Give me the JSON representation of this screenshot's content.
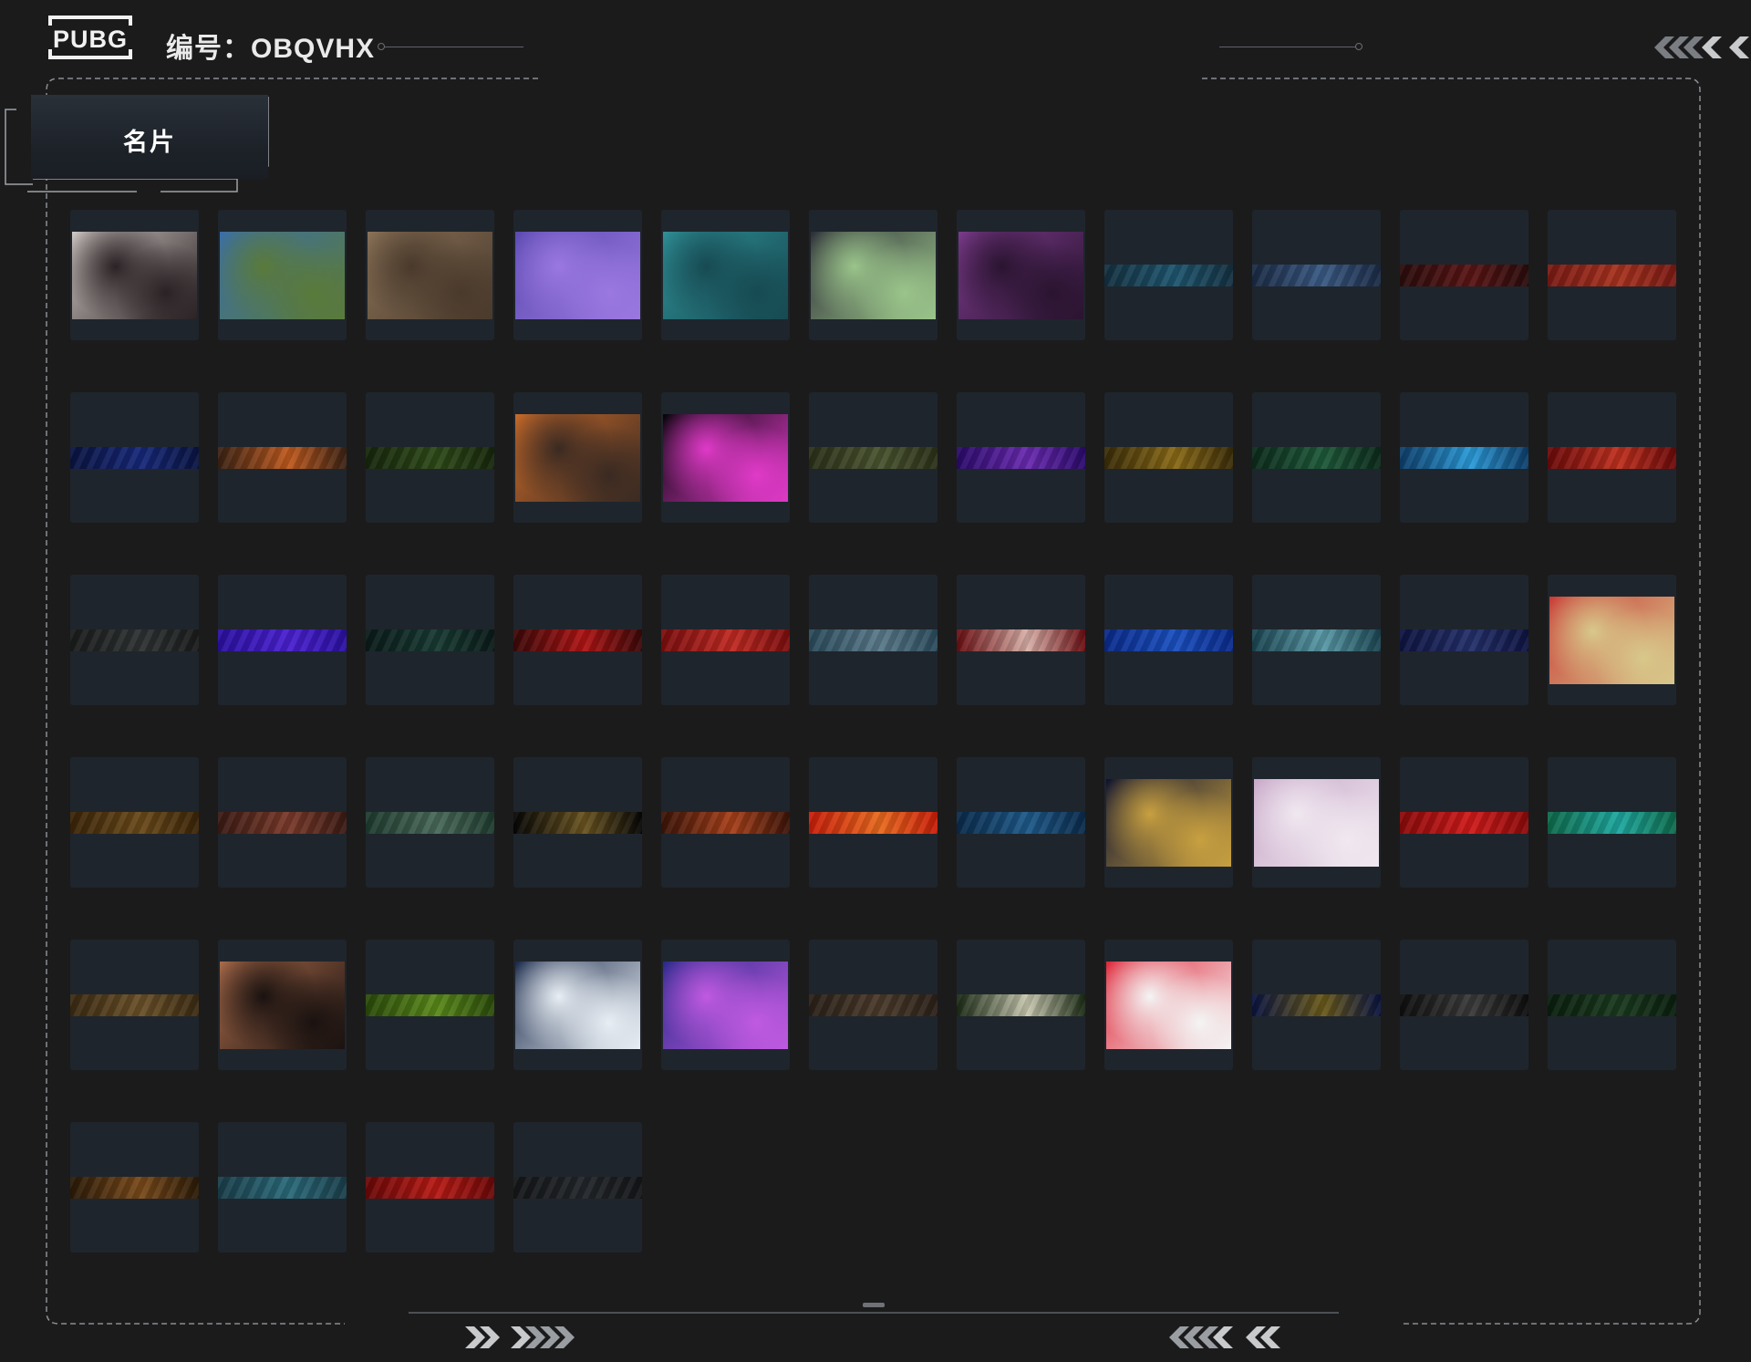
{
  "header": {
    "logo_text": "PUBG",
    "id_label": "编号：OBQVHX"
  },
  "tab": {
    "label": "名片"
  },
  "icons": {
    "header_right": "double-chevron-left-icon",
    "bottom_left": "double-chevron-right-icon",
    "bottom_right": "double-chevron-left-icon"
  },
  "cards": [
    {
      "kind": "image",
      "theme": "woman-portrait-black-nails",
      "c1": "#cfc8c4",
      "c2": "#2a2224"
    },
    {
      "kind": "image",
      "theme": "man-blue-shirt-field",
      "c1": "#3a6ea8",
      "c2": "#5a7a3a"
    },
    {
      "kind": "image",
      "theme": "soldier-desert",
      "c1": "#8a7258",
      "c2": "#4a3a2c"
    },
    {
      "kind": "image",
      "theme": "purple-disco-ball",
      "c1": "#5b4ab0",
      "c2": "#9a78e0"
    },
    {
      "kind": "image",
      "theme": "teal-handprint",
      "c1": "#2f8f96",
      "c2": "#174a52"
    },
    {
      "kind": "image",
      "theme": "man-sunglasses-money",
      "c1": "#2e2f38",
      "c2": "#9ac48a"
    },
    {
      "kind": "image",
      "theme": "purple-hair-woman",
      "c1": "#7a3a8a",
      "c2": "#2a1430"
    },
    {
      "kind": "strip",
      "theme": "blue-circuit",
      "c1": "#143040",
      "c2": "#1e5670"
    },
    {
      "kind": "strip",
      "theme": "moon-phases",
      "c1": "#1a2a44",
      "c2": "#3a5a84"
    },
    {
      "kind": "strip",
      "theme": "dark-red",
      "c1": "#2a0c0c",
      "c2": "#5a1414"
    },
    {
      "kind": "strip",
      "theme": "red-cards",
      "c1": "#7a1a14",
      "c2": "#a8321e"
    },
    {
      "kind": "strip",
      "theme": "navy-lines",
      "c1": "#0a1440",
      "c2": "#16287a"
    },
    {
      "kind": "strip",
      "theme": "brown-orange-dna",
      "c1": "#3a2214",
      "c2": "#c05a1e"
    },
    {
      "kind": "strip",
      "theme": "dark-green-camo",
      "c1": "#16260c",
      "c2": "#2e4a18"
    },
    {
      "kind": "image",
      "theme": "comic-monster",
      "c1": "#c86a2a",
      "c2": "#3a2a22"
    },
    {
      "kind": "image",
      "theme": "pink-equalizer",
      "c1": "#050508",
      "c2": "#e03ac8"
    },
    {
      "kind": "strip",
      "theme": "olive-text",
      "c1": "#2a3018",
      "c2": "#4a5430"
    },
    {
      "kind": "strip",
      "theme": "purple-blue-swirl",
      "c1": "#2a0a6a",
      "c2": "#6a2ab0"
    },
    {
      "kind": "strip",
      "theme": "gold-symbols",
      "c1": "#3a2c08",
      "c2": "#8a6a16"
    },
    {
      "kind": "strip",
      "theme": "green-pattern",
      "c1": "#0c2a1a",
      "c2": "#1e5a3a"
    },
    {
      "kind": "strip",
      "theme": "bright-blue-glow",
      "c1": "#0e3e6a",
      "c2": "#2a9ad8"
    },
    {
      "kind": "strip",
      "theme": "red-ornate",
      "c1": "#6a0a0a",
      "c2": "#c0301e"
    },
    {
      "kind": "strip",
      "theme": "charcoal-texture",
      "c1": "#1a1c1c",
      "c2": "#2e3232"
    },
    {
      "kind": "strip",
      "theme": "violet-texture",
      "c1": "#2a10a0",
      "c2": "#4a20d0"
    },
    {
      "kind": "strip",
      "theme": "dark-teal-dragon",
      "c1": "#0a1a18",
      "c2": "#183a32"
    },
    {
      "kind": "strip",
      "theme": "deep-red-streak",
      "c1": "#3a0808",
      "c2": "#b01414"
    },
    {
      "kind": "strip",
      "theme": "red-circles",
      "c1": "#7a0e0e",
      "c2": "#c02a22"
    },
    {
      "kind": "strip",
      "theme": "mountains-dusk",
      "c1": "#2a4a5a",
      "c2": "#5a7a8a"
    },
    {
      "kind": "strip",
      "theme": "red-dragon-scales",
      "c1": "#6a0e12",
      "c2": "#d8b0a8"
    },
    {
      "kind": "strip",
      "theme": "royal-blue-pattern",
      "c1": "#0a2a8a",
      "c2": "#1a50c0"
    },
    {
      "kind": "strip",
      "theme": "teal-dragon",
      "c1": "#1a4450",
      "c2": "#5a9aa8"
    },
    {
      "kind": "strip",
      "theme": "midnight-pattern",
      "c1": "#0e1440",
      "c2": "#24306a"
    },
    {
      "kind": "image",
      "theme": "red-hooded-skull",
      "c1": "#c83a36",
      "c2": "#d8c88a"
    },
    {
      "kind": "strip",
      "theme": "brown-gold-texture",
      "c1": "#3a2408",
      "c2": "#6a4a1a"
    },
    {
      "kind": "strip",
      "theme": "rust-swirl",
      "c1": "#3a1a14",
      "c2": "#7a3a2a"
    },
    {
      "kind": "strip",
      "theme": "green-paint-hand",
      "c1": "#1e3a2e",
      "c2": "#4a6a5a"
    },
    {
      "kind": "strip",
      "theme": "black-gold-ornament",
      "c1": "#060606",
      "c2": "#6a5420"
    },
    {
      "kind": "strip",
      "theme": "orange-ornate",
      "c1": "#3a1408",
      "c2": "#a8401a"
    },
    {
      "kind": "strip",
      "theme": "bright-red-orange",
      "c1": "#c81e0a",
      "c2": "#e86a1e"
    },
    {
      "kind": "strip",
      "theme": "deep-blue-wave",
      "c1": "#0a2a4a",
      "c2": "#1e5a8a"
    },
    {
      "kind": "image",
      "theme": "night-gold-text",
      "c1": "#0e1230",
      "c2": "#c8a040"
    },
    {
      "kind": "image",
      "theme": "cute-bunnies-pink",
      "c1": "#c8a8c8",
      "c2": "#f0e8f0"
    },
    {
      "kind": "strip",
      "theme": "crimson-ribbon",
      "c1": "#8a0a0a",
      "c2": "#d01a1a"
    },
    {
      "kind": "strip",
      "theme": "emerald-cyan",
      "c1": "#0e6a4a",
      "c2": "#1ea8a0"
    },
    {
      "kind": "strip",
      "theme": "snake-skin",
      "c1": "#3a2a12",
      "c2": "#6a5028"
    },
    {
      "kind": "image",
      "theme": "sniper-silhouette",
      "c1": "#a86a4a",
      "c2": "#1a1210"
    },
    {
      "kind": "strip",
      "theme": "lime-camo",
      "c1": "#2a4a0a",
      "c2": "#5a8a1a"
    },
    {
      "kind": "image",
      "theme": "astronaut-earth",
      "c1": "#1a2a4a",
      "c2": "#e8eef4"
    },
    {
      "kind": "image",
      "theme": "neon-race-track",
      "c1": "#2a2a8a",
      "c2": "#c05ae0"
    },
    {
      "kind": "strip",
      "theme": "dusty-brown",
      "c1": "#2a2018",
      "c2": "#4a3a2a"
    },
    {
      "kind": "strip",
      "theme": "shark-teeth",
      "c1": "#1a2a14",
      "c2": "#c8c8b0"
    },
    {
      "kind": "image",
      "theme": "red-race-car",
      "c1": "#e0283a",
      "c2": "#f4f4f4"
    },
    {
      "kind": "strip",
      "theme": "navy-gold-wave",
      "c1": "#0a1440",
      "c2": "#6a5a1a"
    },
    {
      "kind": "strip",
      "theme": "black-graffiti",
      "c1": "#0e0e0e",
      "c2": "#3a3a3a"
    },
    {
      "kind": "strip",
      "theme": "dark-green-eye",
      "c1": "#0a1e0e",
      "c2": "#1a3a1e"
    },
    {
      "kind": "strip",
      "theme": "wood-grain",
      "c1": "#2a1a08",
      "c2": "#7a4a1a"
    },
    {
      "kind": "strip",
      "theme": "teal-geometric",
      "c1": "#1a3e4a",
      "c2": "#2a6a7a"
    },
    {
      "kind": "strip",
      "theme": "red-diamonds",
      "c1": "#6a0808",
      "c2": "#b81a14"
    },
    {
      "kind": "strip",
      "theme": "shadow-grey",
      "c1": "#141618",
      "c2": "#22262a"
    }
  ]
}
